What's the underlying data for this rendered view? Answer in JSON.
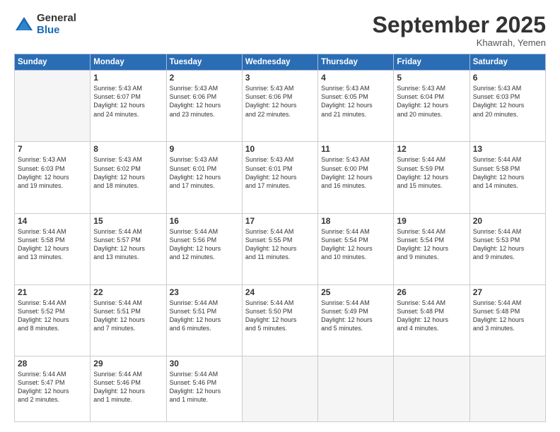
{
  "header": {
    "logo_general": "General",
    "logo_blue": "Blue",
    "month_title": "September 2025",
    "location": "Khawrah, Yemen"
  },
  "days_of_week": [
    "Sunday",
    "Monday",
    "Tuesday",
    "Wednesday",
    "Thursday",
    "Friday",
    "Saturday"
  ],
  "weeks": [
    [
      {
        "day": "",
        "info": ""
      },
      {
        "day": "1",
        "info": "Sunrise: 5:43 AM\nSunset: 6:07 PM\nDaylight: 12 hours\nand 24 minutes."
      },
      {
        "day": "2",
        "info": "Sunrise: 5:43 AM\nSunset: 6:06 PM\nDaylight: 12 hours\nand 23 minutes."
      },
      {
        "day": "3",
        "info": "Sunrise: 5:43 AM\nSunset: 6:06 PM\nDaylight: 12 hours\nand 22 minutes."
      },
      {
        "day": "4",
        "info": "Sunrise: 5:43 AM\nSunset: 6:05 PM\nDaylight: 12 hours\nand 21 minutes."
      },
      {
        "day": "5",
        "info": "Sunrise: 5:43 AM\nSunset: 6:04 PM\nDaylight: 12 hours\nand 20 minutes."
      },
      {
        "day": "6",
        "info": "Sunrise: 5:43 AM\nSunset: 6:03 PM\nDaylight: 12 hours\nand 20 minutes."
      }
    ],
    [
      {
        "day": "7",
        "info": "Sunrise: 5:43 AM\nSunset: 6:03 PM\nDaylight: 12 hours\nand 19 minutes."
      },
      {
        "day": "8",
        "info": "Sunrise: 5:43 AM\nSunset: 6:02 PM\nDaylight: 12 hours\nand 18 minutes."
      },
      {
        "day": "9",
        "info": "Sunrise: 5:43 AM\nSunset: 6:01 PM\nDaylight: 12 hours\nand 17 minutes."
      },
      {
        "day": "10",
        "info": "Sunrise: 5:43 AM\nSunset: 6:01 PM\nDaylight: 12 hours\nand 17 minutes."
      },
      {
        "day": "11",
        "info": "Sunrise: 5:43 AM\nSunset: 6:00 PM\nDaylight: 12 hours\nand 16 minutes."
      },
      {
        "day": "12",
        "info": "Sunrise: 5:44 AM\nSunset: 5:59 PM\nDaylight: 12 hours\nand 15 minutes."
      },
      {
        "day": "13",
        "info": "Sunrise: 5:44 AM\nSunset: 5:58 PM\nDaylight: 12 hours\nand 14 minutes."
      }
    ],
    [
      {
        "day": "14",
        "info": "Sunrise: 5:44 AM\nSunset: 5:58 PM\nDaylight: 12 hours\nand 13 minutes."
      },
      {
        "day": "15",
        "info": "Sunrise: 5:44 AM\nSunset: 5:57 PM\nDaylight: 12 hours\nand 13 minutes."
      },
      {
        "day": "16",
        "info": "Sunrise: 5:44 AM\nSunset: 5:56 PM\nDaylight: 12 hours\nand 12 minutes."
      },
      {
        "day": "17",
        "info": "Sunrise: 5:44 AM\nSunset: 5:55 PM\nDaylight: 12 hours\nand 11 minutes."
      },
      {
        "day": "18",
        "info": "Sunrise: 5:44 AM\nSunset: 5:54 PM\nDaylight: 12 hours\nand 10 minutes."
      },
      {
        "day": "19",
        "info": "Sunrise: 5:44 AM\nSunset: 5:54 PM\nDaylight: 12 hours\nand 9 minutes."
      },
      {
        "day": "20",
        "info": "Sunrise: 5:44 AM\nSunset: 5:53 PM\nDaylight: 12 hours\nand 9 minutes."
      }
    ],
    [
      {
        "day": "21",
        "info": "Sunrise: 5:44 AM\nSunset: 5:52 PM\nDaylight: 12 hours\nand 8 minutes."
      },
      {
        "day": "22",
        "info": "Sunrise: 5:44 AM\nSunset: 5:51 PM\nDaylight: 12 hours\nand 7 minutes."
      },
      {
        "day": "23",
        "info": "Sunrise: 5:44 AM\nSunset: 5:51 PM\nDaylight: 12 hours\nand 6 minutes."
      },
      {
        "day": "24",
        "info": "Sunrise: 5:44 AM\nSunset: 5:50 PM\nDaylight: 12 hours\nand 5 minutes."
      },
      {
        "day": "25",
        "info": "Sunrise: 5:44 AM\nSunset: 5:49 PM\nDaylight: 12 hours\nand 5 minutes."
      },
      {
        "day": "26",
        "info": "Sunrise: 5:44 AM\nSunset: 5:48 PM\nDaylight: 12 hours\nand 4 minutes."
      },
      {
        "day": "27",
        "info": "Sunrise: 5:44 AM\nSunset: 5:48 PM\nDaylight: 12 hours\nand 3 minutes."
      }
    ],
    [
      {
        "day": "28",
        "info": "Sunrise: 5:44 AM\nSunset: 5:47 PM\nDaylight: 12 hours\nand 2 minutes."
      },
      {
        "day": "29",
        "info": "Sunrise: 5:44 AM\nSunset: 5:46 PM\nDaylight: 12 hours\nand 1 minute."
      },
      {
        "day": "30",
        "info": "Sunrise: 5:44 AM\nSunset: 5:46 PM\nDaylight: 12 hours\nand 1 minute."
      },
      {
        "day": "",
        "info": ""
      },
      {
        "day": "",
        "info": ""
      },
      {
        "day": "",
        "info": ""
      },
      {
        "day": "",
        "info": ""
      }
    ]
  ]
}
